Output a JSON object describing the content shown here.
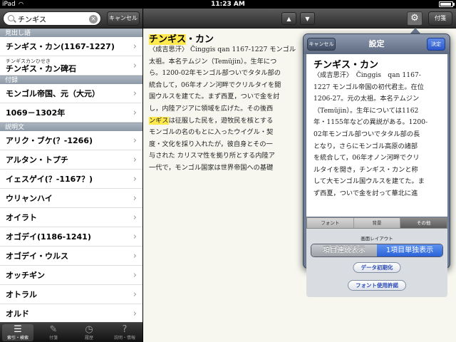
{
  "status": {
    "carrier": "iPad",
    "time": "11:23 AM"
  },
  "search": {
    "query": "チンギス",
    "cancel": "キャンセル"
  },
  "sections": [
    {
      "title": "見出し語",
      "items": [
        {
          "label": "チンギス・カン(1167-1227)"
        },
        {
          "ruby": "チンギスカンひせき",
          "label": "チンギス・カン碑石"
        }
      ]
    },
    {
      "title": "付録",
      "items": [
        {
          "label": "モンゴル帝国、元（大元）"
        },
        {
          "label": "1069－1302年"
        }
      ]
    },
    {
      "title": "説明文",
      "items": [
        {
          "label": "アリク・ブケ(？-1266)"
        },
        {
          "label": "アルタン・トプチ"
        },
        {
          "label": "イェスゲイ(？-1167？)"
        },
        {
          "label": "ウリャンハイ"
        },
        {
          "label": "オイラト"
        },
        {
          "label": "オゴデイ(1186-1241)"
        },
        {
          "label": "オゴデイ・ウルス"
        },
        {
          "label": "オッチギン"
        },
        {
          "label": "オトラル"
        },
        {
          "label": "オルド"
        }
      ]
    }
  ],
  "tabs": [
    {
      "label": "索引・検索",
      "icon": "list-icon"
    },
    {
      "label": "付箋",
      "icon": "pencil-icon"
    },
    {
      "label": "履歴",
      "icon": "clock-icon"
    },
    {
      "label": "説明・情報",
      "icon": "question-icon"
    }
  ],
  "toolbar": {
    "up": "▲",
    "down": "▼",
    "fusen": "付箋"
  },
  "article": {
    "headword_highlight": "チンギス",
    "headword_rest": "・カン",
    "lines": [
      "〈成吉思汗〉 Činggis qan 1167-1227 モンゴル",
      "太祖。本名テムジン（Temüjin）。生年につ",
      "ら。1200-02年モンゴル部ついでタタル部の",
      "統合して，06年オノン河畔でクリルタイを開",
      "国ウルスを建てた。まず西夏，ついで金を討",
      "し，内陸アジアに領域を広げた。その後西",
      "ンギスは征服した民を，遊牧民を核とする",
      "モンゴルの名のもとに入ったウイグル・契",
      "度・文化を採り入れたが，彼自身とその一",
      "与された カリスマ性を拠り所とする内陸ア",
      "一代で，モンゴル国家は世界帝国への基礎"
    ]
  },
  "settings": {
    "title": "設定",
    "cancel": "キャンセル",
    "done": "決定",
    "preview_headword": "チンギス・カン",
    "preview_lines": [
      "〈成吉思汗〉　Činggis　qan 1167-",
      "1227 モンゴル帝国の初代君主。在位",
      "1206-27。元の太祖。本名テムジン",
      "（Temüjin）。生年については1162",
      "年・1155年などの異説がある。1200-",
      "02年モンゴル部ついでタタル部の長",
      "となり，さらにモンゴル高原の諸部",
      "を統合して，06年オノン河畔でクリ",
      "ルタイを開き，チンギス・カンと称",
      "して大モンゴル国ウルスを建てた。ま",
      "ず西夏，ついで金を討って華北に進"
    ],
    "tabs": [
      "フォント",
      "背景",
      "その他"
    ],
    "active_tab": "その他",
    "layout_label": "画面レイアウト",
    "layout_options": [
      "項目連続表示",
      "1項目単独表示"
    ],
    "layout_selected": "1項目単独表示",
    "reset_button": "データ初期化",
    "font_license_button": "フォント使用許諾"
  }
}
